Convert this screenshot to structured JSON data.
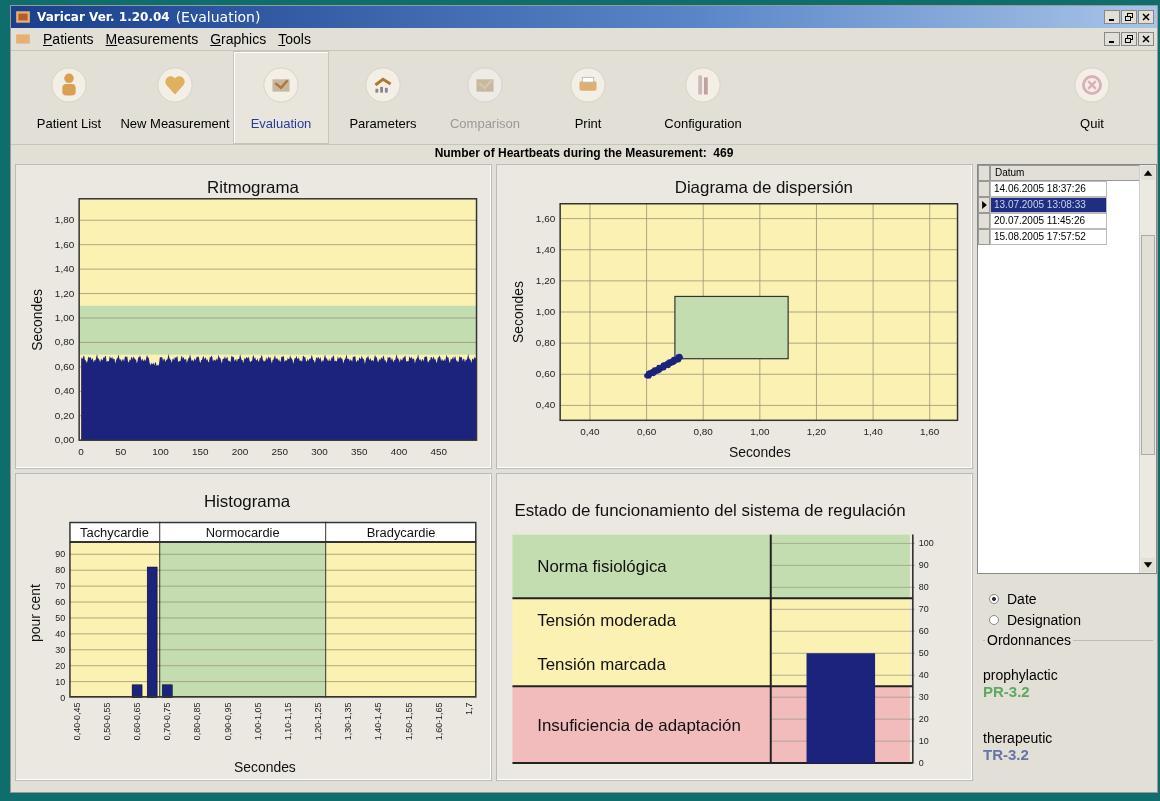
{
  "window": {
    "title": "Varicar Ver. 1.20.04",
    "subtitle": "(Evaluation)"
  },
  "menu": [
    "Patients",
    "Measurements",
    "Graphics",
    "Tools"
  ],
  "toolbar": [
    {
      "label": "Patient List",
      "kind": "person",
      "selected": false,
      "disabled": false
    },
    {
      "label": "New Measurement",
      "kind": "heart",
      "selected": false,
      "disabled": false
    },
    {
      "label": "Evaluation",
      "kind": "check",
      "selected": true,
      "disabled": false
    },
    {
      "label": "Parameters",
      "kind": "chart",
      "selected": false,
      "disabled": false
    },
    {
      "label": "Comparison",
      "kind": "check",
      "selected": false,
      "disabled": true
    },
    {
      "label": "Print",
      "kind": "printer",
      "selected": false,
      "disabled": false
    },
    {
      "label": "Configuration",
      "kind": "tools",
      "selected": false,
      "disabled": false
    },
    {
      "label": "Quit",
      "kind": "quit",
      "selected": false,
      "disabled": false
    }
  ],
  "summary": "Number of Heartbeats during the Measurement:  469",
  "rhythmogram": {
    "title": "Ritmograma",
    "ylabel": "Secondes",
    "yticks": [
      "1,80",
      "1,60",
      "1,40",
      "1,20",
      "1,00",
      "0,80",
      "0,60",
      "0,40",
      "0,20",
      "0,00"
    ],
    "xticks": [
      "0",
      "50",
      "100",
      "150",
      "200",
      "250",
      "300",
      "350",
      "400",
      "450"
    ]
  },
  "scatter": {
    "title": "Diagrama de dispersión",
    "ylabel": "Secondes",
    "xlabel": "Secondes",
    "yticks": [
      "1,60",
      "1,40",
      "1,20",
      "1,00",
      "0,80",
      "0,60",
      "0,40"
    ],
    "xticks": [
      "0,40",
      "0,60",
      "0,80",
      "1,00",
      "1,20",
      "1,40",
      "1,60"
    ]
  },
  "histogram": {
    "chart_data": {
      "type": "bar",
      "title": "Histograma",
      "xlabel": "Secondes",
      "ylabel": "pour cent",
      "categories": [
        "0,40-0,45",
        null,
        "0,50-0,55",
        null,
        "0,60-0,65",
        null,
        "0,70-0,75",
        null,
        "0,80-0,85",
        null,
        "0,90-0,95",
        null,
        "1,00-1,05",
        null,
        "1,10-1,15",
        null,
        "1,20-1,25",
        null,
        "1,30-1,35",
        null,
        "1,40-1,45",
        null,
        "1,50-1,55",
        null,
        "1,60-1,65",
        null,
        "1,7"
      ],
      "values": [
        null,
        null,
        null,
        null,
        8,
        82,
        8,
        null,
        null,
        null,
        null,
        null,
        null,
        null,
        null,
        null,
        null,
        null,
        null,
        null,
        null,
        null,
        null,
        null,
        null,
        null,
        null
      ],
      "ylim": [
        0,
        98
      ],
      "yticks": [
        0,
        10,
        20,
        30,
        40,
        50,
        60,
        70,
        80,
        90
      ],
      "grid": true
    },
    "zones": [
      {
        "label": "Tachycardie",
        "color": "#fbf1b2"
      },
      {
        "label": "Normocardie",
        "color": "#c3ddb0"
      },
      {
        "label": "Bradycardie",
        "color": "#fbf1b2"
      }
    ]
  },
  "regulation": {
    "chart_data": {
      "type": "bar",
      "title": "Estado de funcionamiento del sistema de regulación",
      "values": [
        50
      ],
      "ylim": [
        0,
        104
      ],
      "yticks": [
        0,
        10,
        20,
        30,
        40,
        50,
        60,
        70,
        80,
        90,
        100
      ],
      "grid": true,
      "bands": [
        {
          "axis": "y",
          "from": 75,
          "to": 104,
          "label": "Norma fisiológica",
          "color": "#c3ddb0"
        },
        {
          "axis": "y",
          "from": 55,
          "to": 75,
          "label": "Tensión moderada",
          "color": "#fbf1b2"
        },
        {
          "axis": "y",
          "from": 35,
          "to": 55,
          "label": "Tensión marcada",
          "color": "#fbf1b2"
        },
        {
          "axis": "y",
          "from": 0,
          "to": 35,
          "label": "Insuficiencia de adaptación",
          "color": "#f3bcbc"
        }
      ],
      "ref_lines": [
        {
          "axis": "y",
          "value": 75
        },
        {
          "axis": "y",
          "value": 35
        }
      ]
    }
  },
  "measurements": {
    "column": "Datum",
    "rows": [
      {
        "date": "14.06.2005 18:37:26",
        "selected": false
      },
      {
        "date": "13.07.2005 13:08:33",
        "selected": true
      },
      {
        "date": "20.07.2005 11:45:26",
        "selected": false
      },
      {
        "date": "15.08.2005 17:57:52",
        "selected": false
      }
    ]
  },
  "sort": [
    {
      "label": "Date",
      "selected": true
    },
    {
      "label": "Designation",
      "selected": false
    }
  ],
  "prescriptions": {
    "title": "Ordonnances",
    "items": [
      {
        "label": "prophylactic",
        "code": "PR-3.2",
        "color": "#5fa860"
      },
      {
        "label": "therapeutic",
        "code": "TR-3.2",
        "color": "#6674a8"
      }
    ]
  }
}
